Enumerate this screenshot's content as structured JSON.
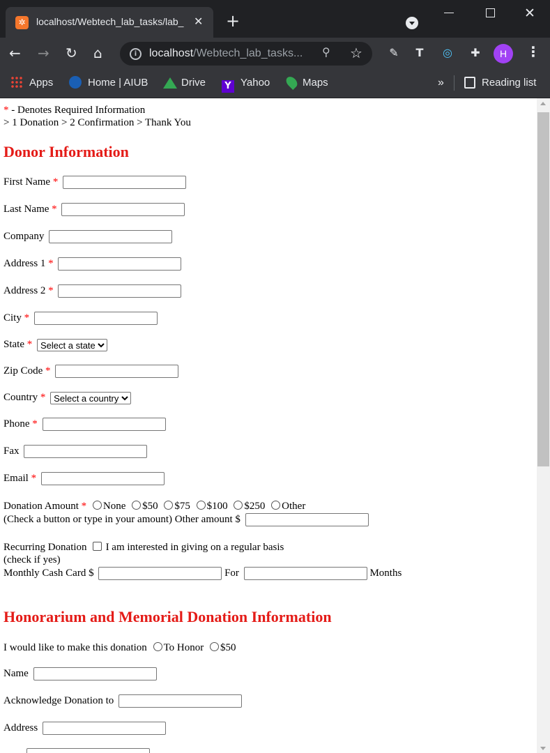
{
  "browser": {
    "tab_title": "localhost/Webtech_lab_tasks/lab_",
    "url_host": "localhost",
    "url_path": "/Webtech_lab_tasks...",
    "profile_initial": "H",
    "bookmarks": [
      "Apps",
      "Home | AIUB",
      "Drive",
      "Yahoo",
      "Maps"
    ],
    "more_bookmarks": "»",
    "reading_list": "Reading list"
  },
  "page": {
    "required_note_star": "*",
    "required_note": " - Denotes Required Information",
    "steps": "> 1 Donation > 2 Confirmation > Thank You",
    "donor_heading": "Donor Information",
    "fields": {
      "first_name": "First Name",
      "last_name": "Last Name",
      "company": "Company",
      "address1": "Address 1",
      "address2": "Address 2",
      "city": "City",
      "state": "State",
      "state_select": "Select a state",
      "zip": "Zip Code",
      "country": "Country",
      "country_select": "Select a country",
      "phone": "Phone",
      "fax": "Fax",
      "email": "Email"
    },
    "donation": {
      "label": "Donation Amount",
      "options": [
        "None",
        "$50",
        "$75",
        "$100",
        "$250",
        "Other"
      ],
      "hint": "(Check a button or type in your amount) Other amount $"
    },
    "recurring": {
      "label": "Recurring Donation",
      "checkbox_label": "I am interested in giving on a regular basis",
      "hint": "(check if yes)",
      "monthly": "Monthly Cash Card $",
      "for": "For",
      "months": "Months"
    },
    "honorarium_heading": "Honorarium and Memorial Donation Information",
    "honor": {
      "label": "I would like to make this donation",
      "options": [
        "To Honor",
        "$50"
      ]
    },
    "honor_name": "Name",
    "acknowledge": "Acknowledge Donation to",
    "honor_address": "Address"
  }
}
